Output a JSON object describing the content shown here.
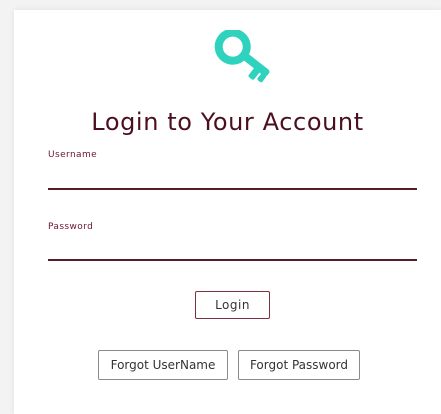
{
  "icon": "key-icon",
  "colors": {
    "accent": "#2fd3bd",
    "brand": "#4b1020",
    "underline": "#5a1a2a"
  },
  "form": {
    "title": "Login to Your Account",
    "username": {
      "label": "Username",
      "value": ""
    },
    "password": {
      "label": "Password",
      "value": ""
    }
  },
  "buttons": {
    "login": "Login",
    "forgot_username": "Forgot UserName",
    "forgot_password": "Forgot Password"
  }
}
